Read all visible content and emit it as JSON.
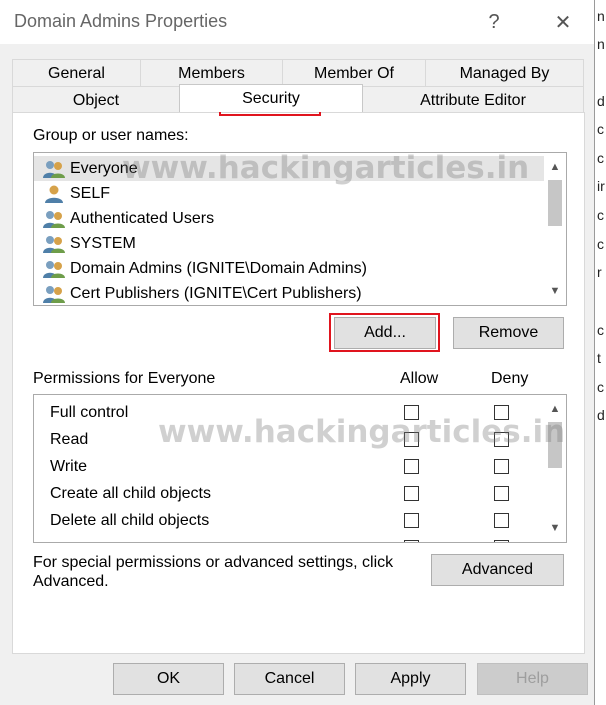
{
  "window": {
    "title": "Domain Admins Properties",
    "help_glyph": "?",
    "close_glyph": "✕"
  },
  "tabs": {
    "row1": [
      "General",
      "Members",
      "Member Of",
      "Managed By"
    ],
    "row2": [
      "Object",
      "Security",
      "Attribute Editor"
    ],
    "active": "Security"
  },
  "group_section": {
    "label": "Group or user names:",
    "items": [
      "Everyone",
      "SELF",
      "Authenticated Users",
      "SYSTEM",
      "Domain Admins (IGNITE\\Domain Admins)",
      "Cert Publishers (IGNITE\\Cert Publishers)"
    ],
    "selected_index": 0,
    "item_icon": "user-group-icon"
  },
  "buttons": {
    "add": "Add...",
    "remove": "Remove",
    "advanced": "Advanced",
    "ok": "OK",
    "cancel": "Cancel",
    "apply": "Apply",
    "help": "Help"
  },
  "permissions": {
    "title": "Permissions for Everyone",
    "allow_header": "Allow",
    "deny_header": "Deny",
    "rows": [
      {
        "name": "Full control",
        "allow": false,
        "deny": false
      },
      {
        "name": "Read",
        "allow": false,
        "deny": false
      },
      {
        "name": "Write",
        "allow": false,
        "deny": false
      },
      {
        "name": "Create all child objects",
        "allow": false,
        "deny": false
      },
      {
        "name": "Delete all child objects",
        "allow": false,
        "deny": false
      }
    ]
  },
  "advanced_text": {
    "line1": "For special permissions or advanced settings, click",
    "line2": "Advanced."
  },
  "watermark": "www.hackingarticles.in",
  "background_chars": [
    "n",
    "n",
    "d",
    "c",
    "c",
    "ir",
    "c",
    "c",
    "r",
    "c",
    "t",
    "c",
    "d"
  ],
  "colors": {
    "highlight": "#e0141e",
    "dialog_bg": "#f0f0f0",
    "selection": "#e5e5e5"
  }
}
